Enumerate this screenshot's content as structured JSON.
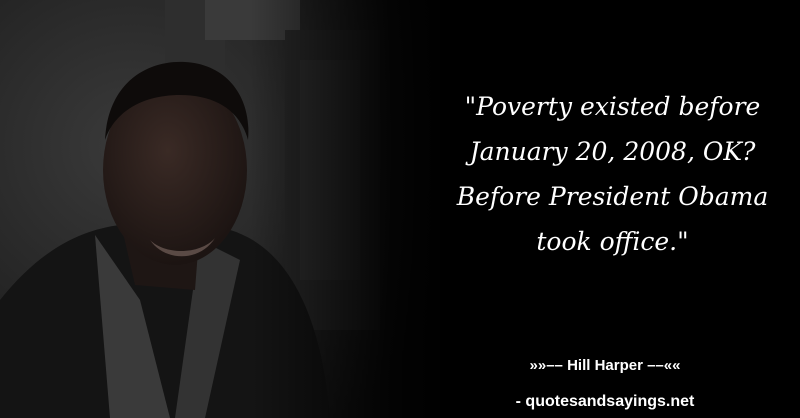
{
  "quote": {
    "lines": [
      "\"Poverty existed before",
      "January 20, 2008, OK?",
      "Before President Obama",
      "took office.\""
    ]
  },
  "attribution": {
    "author_line": "»»–– Hill Harper ––««",
    "source": "- quotesandsayings.net"
  },
  "colors": {
    "background": "#000000",
    "text": "#ffffff"
  }
}
